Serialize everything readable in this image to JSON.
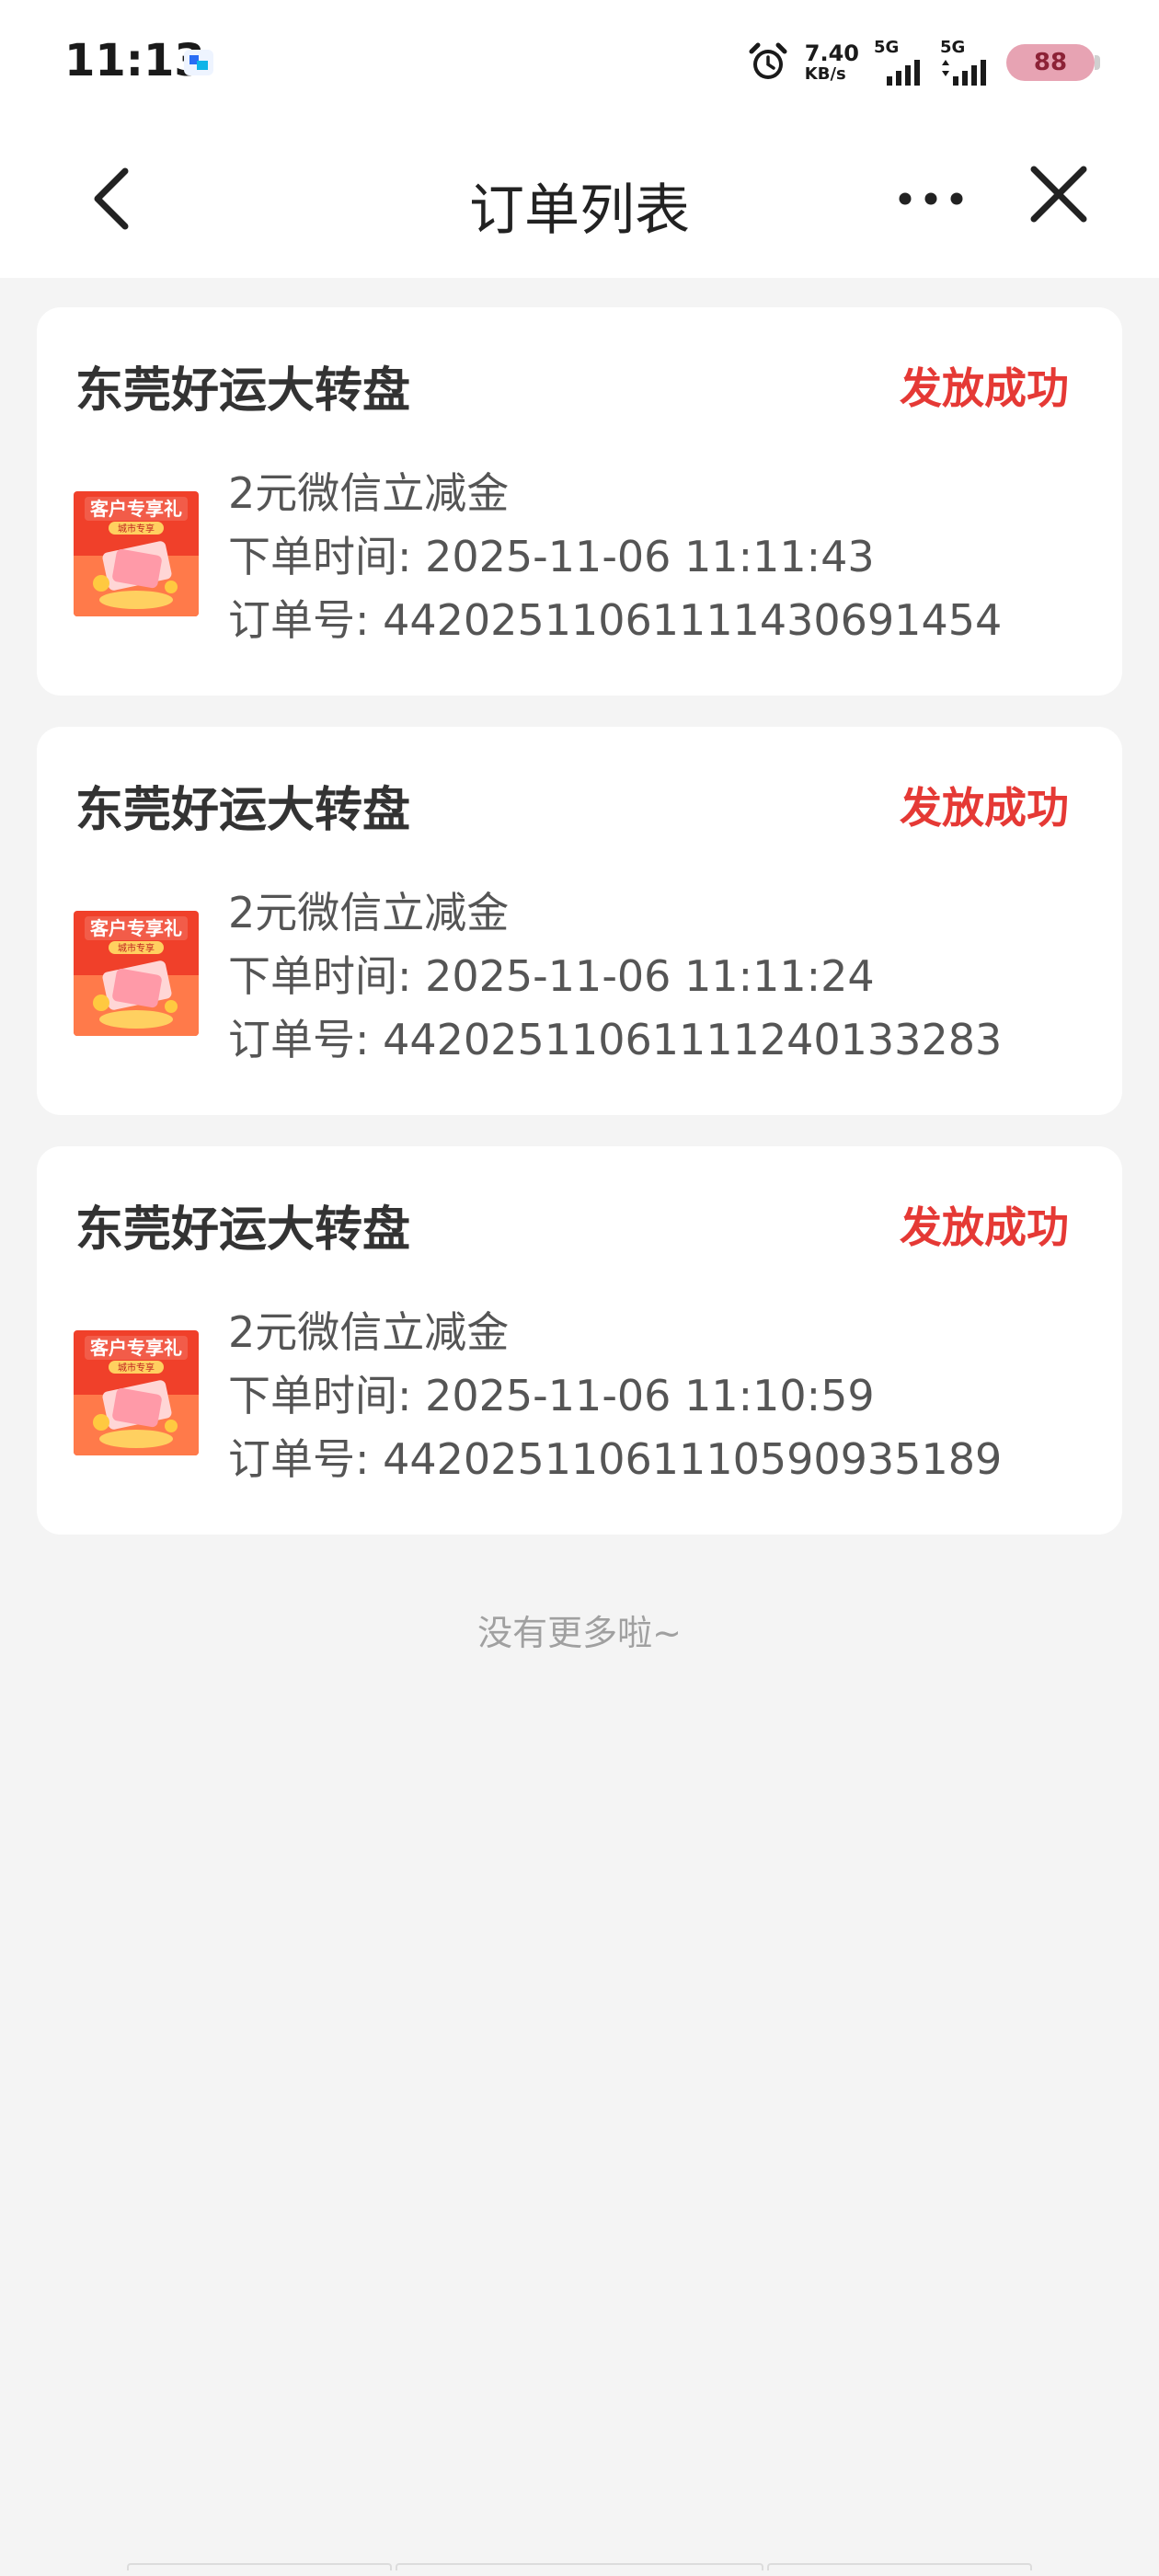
{
  "status_bar": {
    "time": "11:13",
    "net_speed_value": "7.40",
    "net_speed_unit": "KB/s",
    "sim1_tag": "5G",
    "sim2_tag": "5G",
    "battery_level": "88",
    "battery_color": "#e7a3b3"
  },
  "nav": {
    "title": "订单列表",
    "back_icon": "chevron-left-icon",
    "more_icon": "more-horizontal-icon",
    "close_icon": "close-icon"
  },
  "orders": [
    {
      "store": "东莞好运大转盘",
      "status": "发放成功",
      "thumb_badge": "客户专享礼",
      "thumb_sub": "城市专享",
      "product": "2元微信立减金",
      "time_line": "下单时间: 2025-11-06 11:11:43",
      "number_line": "订单号: 4420251106111143069145​4"
    },
    {
      "store": "东莞好运大转盘",
      "status": "发放成功",
      "thumb_badge": "客户专享礼",
      "thumb_sub": "城市专享",
      "product": "2元微信立减金",
      "time_line": "下单时间: 2025-11-06 11:11:24",
      "number_line": "订单号: 442025110611112401332​83"
    },
    {
      "store": "东莞好运大转盘",
      "status": "发放成功",
      "thumb_badge": "客户专享礼",
      "thumb_sub": "城市专享",
      "product": "2元微信立减金",
      "time_line": "下单时间: 2025-11-06 11:10:59",
      "number_line": "订单号: 4420251106111059093518​9"
    }
  ],
  "footer": {
    "no_more": "没有更多啦~"
  },
  "colors": {
    "accent_status": "#e53935",
    "page_bg": "#f4f4f4"
  }
}
